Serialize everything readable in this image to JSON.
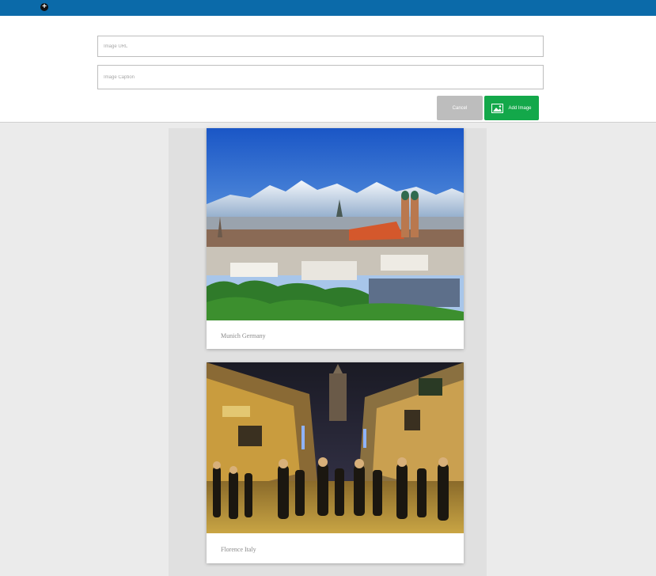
{
  "topbar": {
    "add_icon_glyph": "+",
    "bar_color": "#0b6aa9"
  },
  "form": {
    "image_url_placeholder": "Image URL",
    "image_caption_placeholder": "Image Caption",
    "cancel_label": "Cancel",
    "add_label": "Add Image",
    "add_icon": "image-icon",
    "add_button_color": "#13a84a",
    "cancel_button_color": "#bdbdbd"
  },
  "gallery": {
    "cards": [
      {
        "caption": "Munich Germany",
        "photo": "munich-skyline-photo"
      },
      {
        "caption": "Florence Italy",
        "photo": "florence-street-photo"
      }
    ]
  }
}
